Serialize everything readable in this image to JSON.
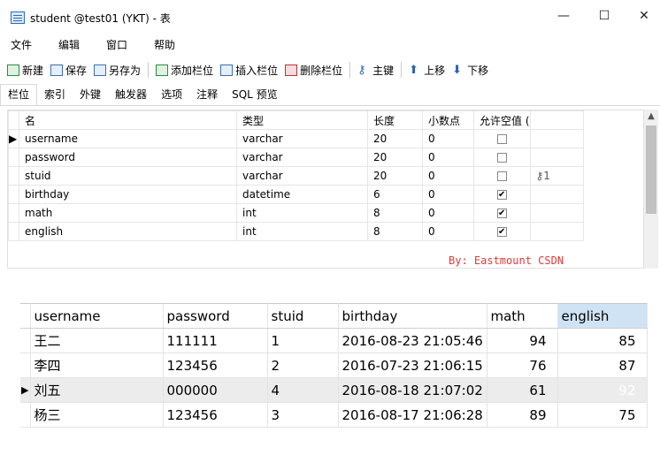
{
  "window": {
    "title": "student @test01 (YKT) - 表",
    "controls": {
      "minimize": "—",
      "maximize": "☐",
      "close": "✕"
    }
  },
  "menu": [
    "文件",
    "编辑",
    "窗口",
    "帮助"
  ],
  "toolbar": {
    "new": "新建",
    "save": "保存",
    "save_as": "另存为",
    "add_field": "添加栏位",
    "insert_field": "插入栏位",
    "delete_field": "删除栏位",
    "primary_key": "主键",
    "move_up": "上移",
    "move_down": "下移"
  },
  "tabs": [
    "栏位",
    "索引",
    "外键",
    "触发器",
    "选项",
    "注释",
    "SQL 预览"
  ],
  "fields": {
    "columns": [
      "名",
      "类型",
      "长度",
      "小数点",
      "允许空值 ("
    ],
    "rows": [
      {
        "name": "username",
        "type": "varchar",
        "length": "20",
        "decimals": "0",
        "nullable": false,
        "key": ""
      },
      {
        "name": "password",
        "type": "varchar",
        "length": "20",
        "decimals": "0",
        "nullable": false,
        "key": ""
      },
      {
        "name": "stuid",
        "type": "varchar",
        "length": "20",
        "decimals": "0",
        "nullable": false,
        "key": "1"
      },
      {
        "name": "birthday",
        "type": "datetime",
        "length": "6",
        "decimals": "0",
        "nullable": true,
        "key": ""
      },
      {
        "name": "math",
        "type": "int",
        "length": "8",
        "decimals": "0",
        "nullable": true,
        "key": ""
      },
      {
        "name": "english",
        "type": "int",
        "length": "8",
        "decimals": "0",
        "nullable": true,
        "key": ""
      }
    ],
    "current_row": 0
  },
  "watermark": "By: Eastmount CSDN",
  "result": {
    "columns": [
      "username",
      "password",
      "stuid",
      "birthday",
      "math",
      "english"
    ],
    "rows": [
      [
        "王二",
        "111111",
        "1",
        "2016-08-23 21:05:46",
        "94",
        "85"
      ],
      [
        "李四",
        "123456",
        "2",
        "2016-07-23 21:06:15",
        "76",
        "87"
      ],
      [
        "刘五",
        "000000",
        "4",
        "2016-08-18 21:07:02",
        "61",
        "92"
      ],
      [
        "杨三",
        "123456",
        "3",
        "2016-08-17 21:06:28",
        "89",
        "75"
      ]
    ],
    "current_row": 2,
    "selected_column": "english"
  },
  "colors": {
    "selection": "#3f97e9",
    "header_selected": "#cfe3f5",
    "watermark": "#e23a3a"
  }
}
